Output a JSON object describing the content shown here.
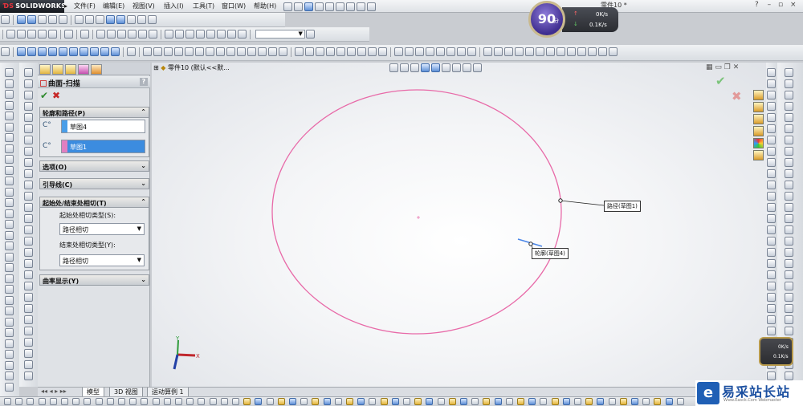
{
  "app": {
    "logo_text": "SOLIDWORKS",
    "doc_title": "零件10 *"
  },
  "menu": {
    "items": [
      "文件(F)",
      "编辑(E)",
      "视图(V)",
      "插入(I)",
      "工具(T)",
      "窗口(W)",
      "帮助(H)"
    ]
  },
  "tree": {
    "root_label": "零件10 (默认<<默..."
  },
  "property_manager": {
    "title": "曲面-扫描",
    "help": "?",
    "ok_symbol": "✔",
    "cancel_symbol": "✖",
    "groups": {
      "profile_path": {
        "title": "轮廓和路径(P)",
        "profile_value": "草图4",
        "path_value": "草图1"
      },
      "options": {
        "title": "选项(O)"
      },
      "guide_curves": {
        "title": "引导线(C)"
      },
      "tangency": {
        "title": "起始处/结束处相切(T)",
        "start_label": "起始处相切类型(S):",
        "start_value": "路径相切",
        "end_label": "结束处相切类型(Y):",
        "end_value": "路径相切"
      },
      "curvature": {
        "title": "曲率显示(Y)"
      }
    }
  },
  "graphics": {
    "path_callout": "路径(草图1)",
    "profile_callout": "轮廓(草图4)",
    "triad_x": "X",
    "triad_y": "Y",
    "colors": {
      "path_ellipse": "#e86aa8",
      "profile_line": "#4a86e8"
    }
  },
  "bottom_tabs": [
    "模型",
    "3D 视图",
    "运动算例 1"
  ],
  "widget": {
    "score": "90",
    "score_unit": "分",
    "up_speed": "0K/s",
    "down_speed": "0.1K/s",
    "mini_up": "0K/s",
    "mini_down": "0.1K/s"
  },
  "watermark": {
    "text": "易采站长站",
    "url": "Www.Easck.Com Webmaster",
    "logo_char": "e"
  }
}
